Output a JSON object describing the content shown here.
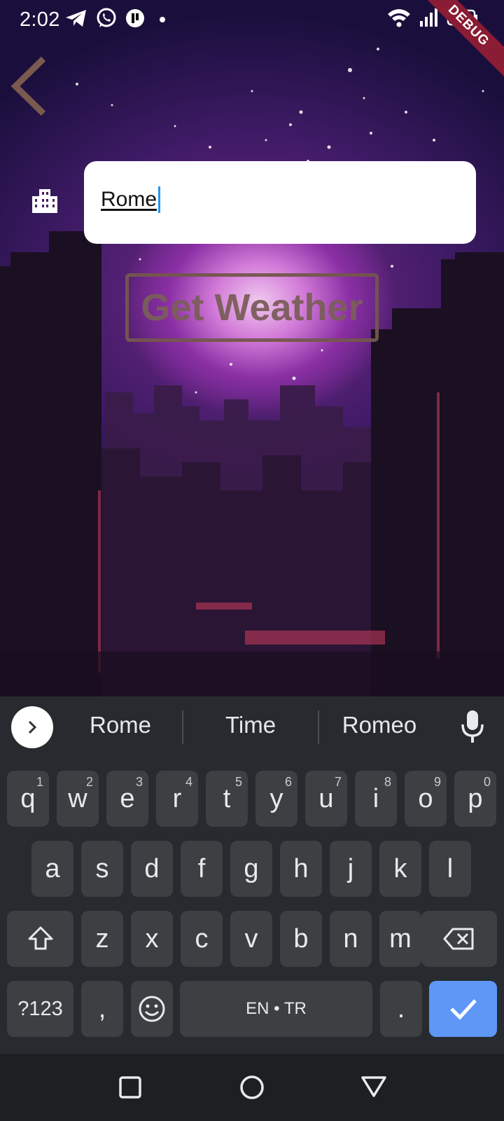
{
  "status_bar": {
    "time": "2:02",
    "left_icons": [
      "telegram-icon",
      "whatsapp-icon",
      "app-icon",
      "dot-icon"
    ],
    "right_icons": [
      "wifi-icon",
      "signal-icon",
      "battery-icon"
    ],
    "debug_label": "DEBUG"
  },
  "app": {
    "city_input": {
      "value": "Rome"
    },
    "get_weather_label": "Get Weather",
    "colors": {
      "button_border": "#75574d",
      "button_text": "#7b5e5a",
      "cursor": "#2196f3"
    }
  },
  "keyboard": {
    "suggestions": [
      "Rome",
      "Time",
      "Romeo"
    ],
    "row1": [
      {
        "key": "q",
        "hint": "1"
      },
      {
        "key": "w",
        "hint": "2"
      },
      {
        "key": "e",
        "hint": "3"
      },
      {
        "key": "r",
        "hint": "4"
      },
      {
        "key": "t",
        "hint": "5"
      },
      {
        "key": "y",
        "hint": "6"
      },
      {
        "key": "u",
        "hint": "7"
      },
      {
        "key": "i",
        "hint": "8"
      },
      {
        "key": "o",
        "hint": "9"
      },
      {
        "key": "p",
        "hint": "0"
      }
    ],
    "row2": [
      "a",
      "s",
      "d",
      "f",
      "g",
      "h",
      "j",
      "k",
      "l"
    ],
    "row3": [
      "z",
      "x",
      "c",
      "v",
      "b",
      "n",
      "m"
    ],
    "symbols_label": "?123",
    "comma_label": ",",
    "space_label": "EN • TR",
    "period_label": ".",
    "colors": {
      "background": "#272b30",
      "key": "#3c4043",
      "enter": "#5e97f6"
    }
  }
}
